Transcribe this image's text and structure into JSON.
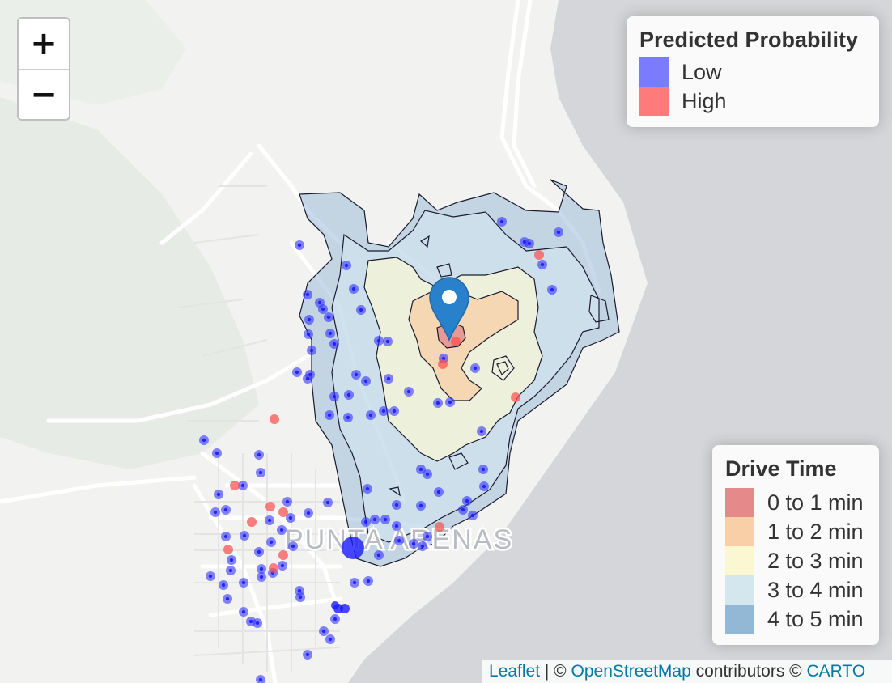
{
  "map": {
    "city_label": "PUNTA ARENAS",
    "colors": {
      "land": "#f2f2f0",
      "water": "#d4d6d9",
      "green": "#e6ebe5",
      "road": "#ffffff",
      "point_low": "#3333ff",
      "point_high": "#ff4a4a",
      "marker": "#2a81cb"
    }
  },
  "zoom": {
    "in_label": "+",
    "out_label": "−"
  },
  "legend_probability": {
    "title": "Predicted Probability",
    "items": [
      {
        "label": "Low",
        "color": "#7b7bff"
      },
      {
        "label": "High",
        "color": "#ff7b7b"
      }
    ]
  },
  "legend_drive_time": {
    "title": "Drive Time",
    "items": [
      {
        "label": "0 to 1 min",
        "color": "#e5898b"
      },
      {
        "label": "1 to 2 min",
        "color": "#f8cfa6"
      },
      {
        "label": "2 to 3 min",
        "color": "#fbf7d3"
      },
      {
        "label": "3 to 4 min",
        "color": "#d4e6ee"
      },
      {
        "label": "4 to 5 min",
        "color": "#93b8d6"
      }
    ]
  },
  "attribution": {
    "leaflet": "Leaflet",
    "sep": " | © ",
    "osm": "OpenStreetMap",
    "contributors": " contributors © ",
    "carto": "CARTO"
  }
}
